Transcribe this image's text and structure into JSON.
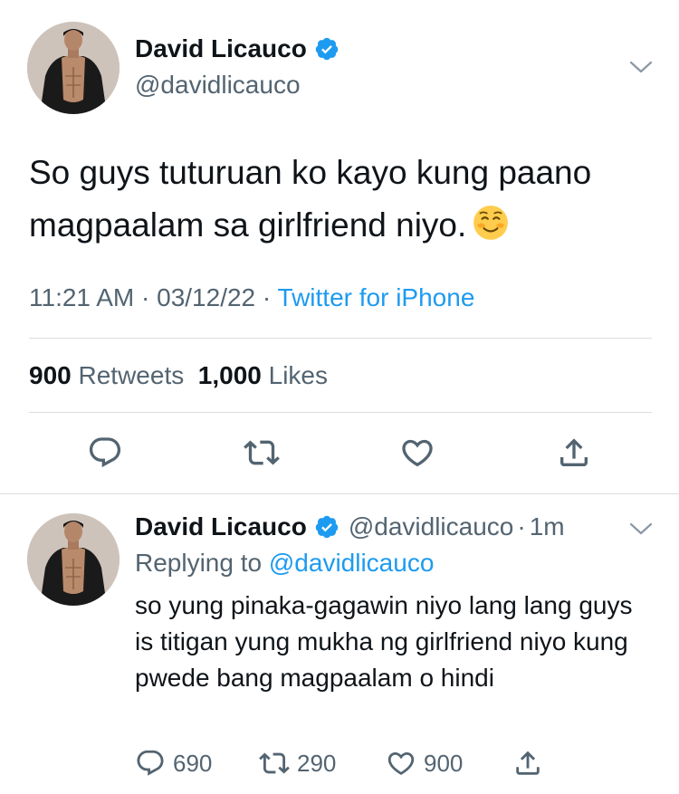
{
  "main_tweet": {
    "author_name": "David Licauco",
    "handle": "@davidlicauco",
    "verified": true,
    "text": "So guys tuturuan ko kayo kung paano magpaalam sa girlfriend niyo.",
    "emoji": "smiling-face-emoji",
    "time": "11:21 AM",
    "separator": "·",
    "date": "03/12/22",
    "source": "Twitter for iPhone",
    "retweet_count": "900",
    "retweet_label": "Retweets",
    "like_count": "1,000",
    "like_label": "Likes",
    "actions": [
      "reply-icon",
      "retweet-icon",
      "like-icon",
      "share-icon"
    ]
  },
  "reply_tweet": {
    "author_name": "David Licauco",
    "handle": "@davidlicauco",
    "separator": "·",
    "time_ago": "1m",
    "replying_to_label": "Replying to",
    "replying_to_handle": "@davidlicauco",
    "text": "so yung pinaka-gagawin niyo lang lang guys is titigan yung mukha ng girlfriend niyo kung pwede bang magpaalam o hindi",
    "reply_count": "690",
    "retweet_count": "290",
    "like_count": "900"
  },
  "colors": {
    "accent": "#1d9bf0",
    "text": "#0f1419",
    "secondary": "#536471",
    "divider": "#d9dee2"
  }
}
